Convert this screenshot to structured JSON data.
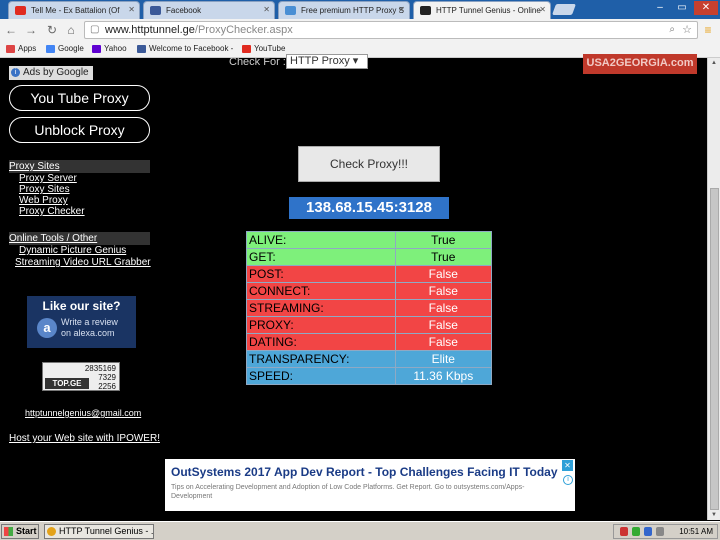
{
  "browser": {
    "tabs": [
      {
        "label": "Tell Me - Ex Battalion (Of",
        "color": "#e02b20"
      },
      {
        "label": "Facebook",
        "color": "#3b5998"
      },
      {
        "label": "Free premium HTTP Proxy S",
        "color": "#4a8fd4"
      },
      {
        "label": "HTTP Tunnel Genius - Online",
        "color": "#222222"
      }
    ],
    "url_host": "www.httptunnel.ge",
    "url_path": "/ProxyChecker.aspx",
    "bookmarks": [
      {
        "label": "Apps",
        "color": "#d44"
      },
      {
        "label": "Google",
        "color": "#4285f4"
      },
      {
        "label": "Yahoo",
        "color": "#5f01d1"
      },
      {
        "label": "Welcome to Facebook -",
        "color": "#3b5998"
      },
      {
        "label": "YouTube",
        "color": "#e02b20"
      }
    ]
  },
  "sidebar": {
    "ads_by": "Ads by Google",
    "youtube_proxy": "You Tube Proxy",
    "unblock_proxy": "Unblock Proxy",
    "proxy_sites_title": "Proxy Sites",
    "proxy_links": [
      "Proxy Server",
      "Proxy Sites",
      "Web Proxy",
      "Proxy Checker"
    ],
    "tools_title": "Online Tools / Other",
    "tool_links": [
      "Dynamic Picture Genius",
      "Streaming Video URL Grabber"
    ],
    "like_title": "Like our site?",
    "like_sub1": "Write a review",
    "like_sub2": "on alexa.com",
    "topge_label": "TOP.GE",
    "topge_nums": [
      "2835169",
      "7329",
      "2256"
    ],
    "email": "httptunnelgenius@gmail.com",
    "host": "Host your Web site with IPOWER!"
  },
  "main": {
    "check_for_label": "Check For :",
    "check_for_value": "HTTP Proxy",
    "banner": "USA2GEORGIA.com",
    "check_button": "Check Proxy!!!",
    "proxy_ip": "138.68.15.45:3128",
    "results": [
      {
        "key": "ALIVE:",
        "value": "True",
        "status": "green"
      },
      {
        "key": "GET:",
        "value": "True",
        "status": "green"
      },
      {
        "key": "POST:",
        "value": "False",
        "status": "red"
      },
      {
        "key": "CONNECT:",
        "value": "False",
        "status": "red"
      },
      {
        "key": "STREAMING:",
        "value": "False",
        "status": "red"
      },
      {
        "key": "PROXY:",
        "value": "False",
        "status": "red"
      },
      {
        "key": "DATING:",
        "value": "False",
        "status": "red"
      },
      {
        "key": "TRANSPARENCY:",
        "value": "Elite",
        "status": "blue"
      },
      {
        "key": "SPEED:",
        "value": "11.36 Kbps",
        "status": "blue"
      }
    ]
  },
  "ad": {
    "headline": "OutSystems 2017 App Dev Report - Top Challenges Facing IT Today",
    "subtext": "Tips on Accelerating Development and Adoption of Low Code Platforms. Get Report. Go to outsystems.com/Apps-Development"
  },
  "taskbar": {
    "start": "Start",
    "item": "HTTP Tunnel Genius - ...",
    "time": "10:51 AM"
  }
}
